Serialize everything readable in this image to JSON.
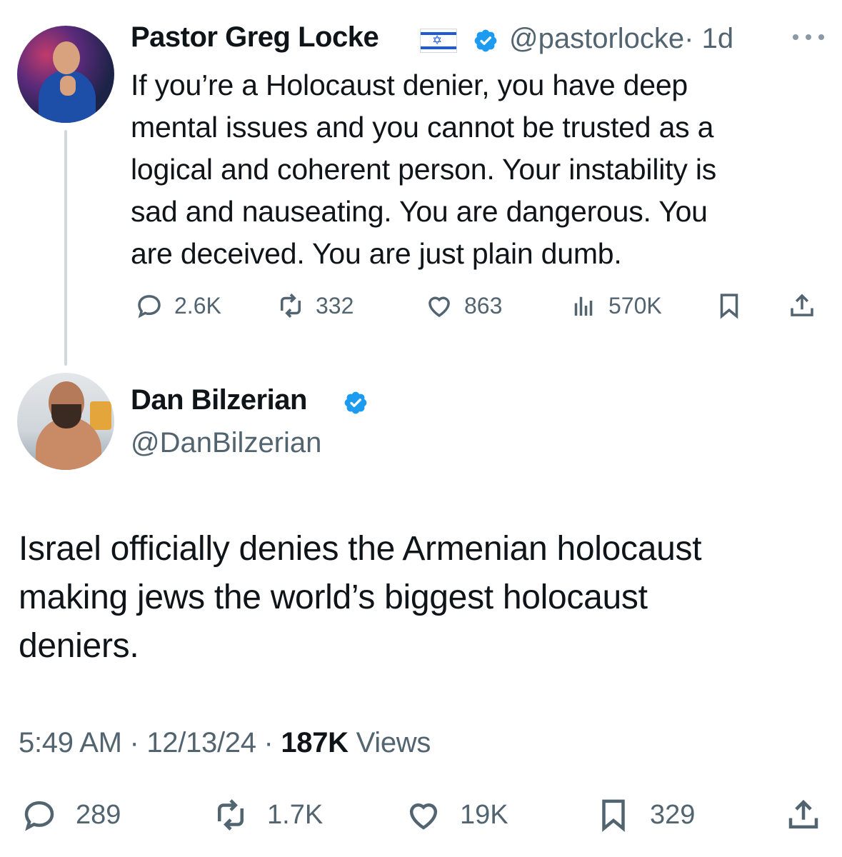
{
  "quoted": {
    "author_name": "Pastor Greg Locke",
    "handle": "@pastorlocke",
    "age": "· 1d",
    "text": "If you’re a Holocaust denier, you have deep\nmental issues and you cannot be trusted as a\nlogical and coherent person. Your instability is\nsad and nauseating. You are dangerous. You\nare deceived. You are just plain dumb.",
    "replies": "2.6K",
    "reposts": "332",
    "likes": "863",
    "views": "570K"
  },
  "main": {
    "author_name": "Dan Bilzerian",
    "handle": "@DanBilzerian",
    "text": "Israel officially denies the Armenian holocaust\nmaking jews the world’s biggest holocaust\ndeniers.",
    "time": "5:49 AM",
    "date": "12/13/24",
    "view_count": "187K",
    "views_label": "Views",
    "replies": "289",
    "reposts": "1.7K",
    "likes": "19K",
    "bookmarks": "329"
  },
  "colors": {
    "text": "#0f1419",
    "secondary": "#536471",
    "verified": "#1d9bf0",
    "thread_line": "#cfd9de"
  },
  "icons": [
    "more-icon",
    "verified-badge-icon",
    "israel-flag-icon",
    "reply-icon",
    "repost-icon",
    "like-icon",
    "views-icon",
    "bookmark-icon",
    "share-icon"
  ]
}
